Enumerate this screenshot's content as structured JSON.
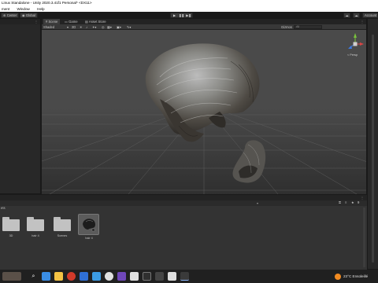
{
  "window": {
    "title": "Linux Standalone - Unity 2020.3.41f1 Personal* <DX11>"
  },
  "menu": {
    "items": [
      "ment",
      "Window",
      "Help"
    ]
  },
  "toolbar": {
    "center_label": "Center",
    "global_label": "Global",
    "play_icons": [
      "▶",
      "❚❚",
      "▶❚"
    ],
    "account_label": "Account"
  },
  "scene": {
    "tabs": [
      {
        "icon": "#",
        "label": "Scene"
      },
      {
        "icon": "▭",
        "label": "Game"
      },
      {
        "icon": "▤",
        "label": "Asset Store"
      }
    ],
    "shading_mode": "Shaded",
    "mode_2d": "2D",
    "gizmos_label": "Gizmos",
    "search_placeholder": "All",
    "persp_label": "< Persp"
  },
  "project": {
    "breadcrumb": "ets",
    "assets": [
      {
        "kind": "folder",
        "label": "3D"
      },
      {
        "kind": "folder",
        "label": "hair 4"
      },
      {
        "kind": "folder",
        "label": "Scenes"
      },
      {
        "kind": "model",
        "label": "hair 4"
      }
    ],
    "count_badge": "9"
  },
  "taskbar": {
    "weather": "23°C  Ensoleillé"
  },
  "colors": {
    "viewport_bg": "#4a4a4a",
    "panel_bg": "#282828",
    "taskbar_bg": "#202020",
    "gizmo_y": "#79c33c",
    "gizmo_x": "#d94545",
    "gizmo_z": "#3c7be6"
  }
}
